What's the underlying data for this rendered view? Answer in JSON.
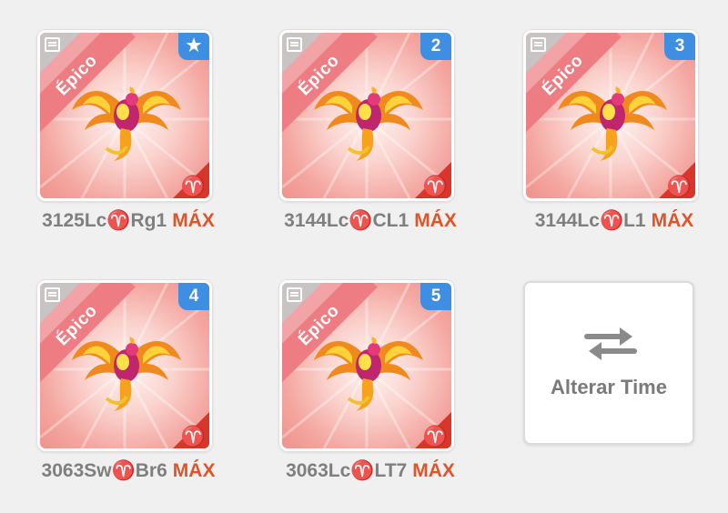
{
  "cards": [
    {
      "rarity": "Épico",
      "slot": "★",
      "element_glyph": "♈",
      "code": "3125Lc♈Rg1",
      "level": "MÁX"
    },
    {
      "rarity": "Épico",
      "slot": "2",
      "element_glyph": "♈",
      "code": "3144Lc♈CL1",
      "level": "MÁX"
    },
    {
      "rarity": "Épico",
      "slot": "3",
      "element_glyph": "♈",
      "code": "3144Lc♈L1",
      "level": "MÁX"
    },
    {
      "rarity": "Épico",
      "slot": "4",
      "element_glyph": "♈",
      "code": "3063Sw♈Br6",
      "level": "MÁX"
    },
    {
      "rarity": "Épico",
      "slot": "5",
      "element_glyph": "♈",
      "code": "3063Lc♈LT7",
      "level": "MÁX"
    }
  ],
  "switch_team": {
    "label": "Alterar Time",
    "icon": "swap-arrows-icon"
  },
  "colors": {
    "rarity_ribbon": "#ee7c83",
    "slot_badge": "#3e8ee1",
    "element_badge": "#d8352b",
    "max_text": "#e0542a",
    "code_text": "#7f7f7f"
  }
}
